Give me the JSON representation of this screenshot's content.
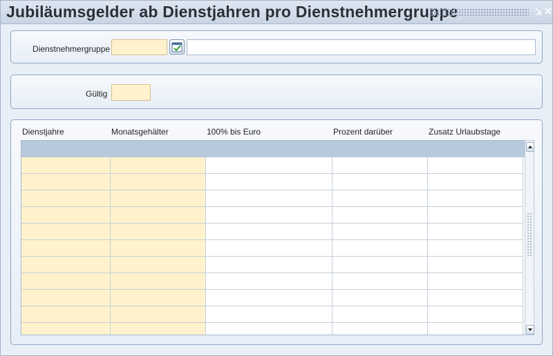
{
  "window": {
    "title": "Jubiläumsgelder ab Dienstjahren pro Dienstnehmergruppe"
  },
  "form": {
    "group_label": "Dienstnehmergruppe",
    "group_code": "",
    "group_name": "",
    "valid_label": "Gültig",
    "valid_value": ""
  },
  "grid": {
    "columns": [
      "Dienstjahre",
      "Monatsgehälter",
      "100% bis Euro",
      "Prozent darüber",
      "Zusatz Urlaubstage"
    ],
    "row_count": 11
  },
  "icons": {
    "lookup": "calendar-check-icon",
    "minimize": "minimize-icon",
    "close": "close-icon",
    "scroll_up": "arrow-up-icon",
    "scroll_down": "arrow-down-icon"
  },
  "colors": {
    "required_field": "#fff2cc",
    "header_row": "#b9c9dc",
    "panel_border": "#8da6c6"
  }
}
